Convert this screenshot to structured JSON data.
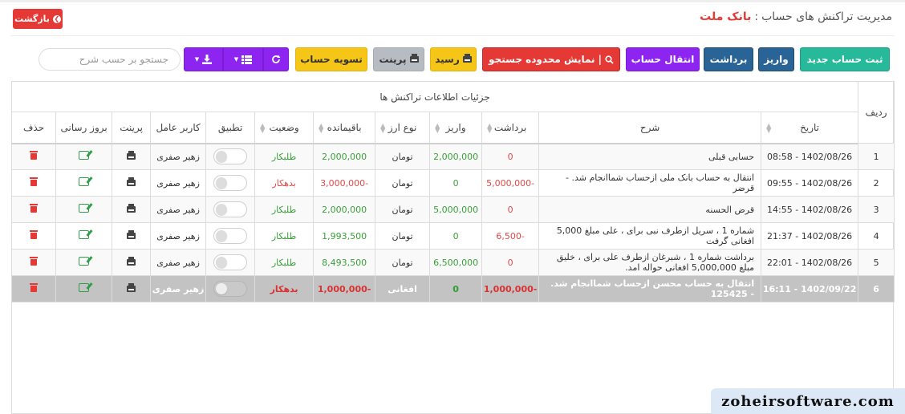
{
  "header": {
    "back_label": "بازگشت",
    "title": "مدیریت تراکنش های حساب",
    "separator": ":",
    "bank_name": "بانک ملت"
  },
  "toolbar": {
    "new_account": "ثبت حساب جدید",
    "deposit": "واریز",
    "withdraw": "برداشت",
    "transfer": "انتقال حساب",
    "show_search_range": "نمایش محدوده جستجو",
    "receipt": "رسید",
    "print": "پرینت",
    "settle": "تسویه حساب",
    "search_placeholder": "جستجو بر حسب شرح"
  },
  "table": {
    "caption": "جزئیات اطلاعات تراکنش ها",
    "columns": {
      "row": "ردیف",
      "date": "تاریخ",
      "description": "شرح",
      "withdraw": "برداشت",
      "deposit": "واریز",
      "currency": "نوع ارز",
      "balance": "باقیمانده",
      "status": "وضعیت",
      "reconcile": "تطبیق",
      "user": "کاربر عامل",
      "print": "پرینت",
      "update": "بروز رسانی",
      "delete": "حذف"
    },
    "rows": [
      {
        "row": "1",
        "date": "1402/08/26 - 08:58",
        "description": "حسابی قبلی",
        "withdraw": "0",
        "deposit": "2,000,000",
        "currency": "تومان",
        "balance": "2,000,000",
        "status": "طلبکار",
        "user": "زهیر صفری"
      },
      {
        "row": "2",
        "date": "1402/08/26 - 09:55",
        "description": "انتقال به حساب بانک ملی ازحساب شماانجام شد. - قرضر",
        "withdraw": "-5,000,000",
        "deposit": "0",
        "currency": "تومان",
        "balance": "-3,000,000",
        "status": "بدهکار",
        "user": "زهیر صفری"
      },
      {
        "row": "3",
        "date": "1402/08/26 - 14:55",
        "description": "قرض الحسنه",
        "withdraw": "0",
        "deposit": "5,000,000",
        "currency": "تومان",
        "balance": "2,000,000",
        "status": "طلبکار",
        "user": "زهیر صفری"
      },
      {
        "row": "4",
        "date": "1402/08/26 - 21:37",
        "description": "شماره 1 ، سریل ازطرف نبی برای ، علی مبلغ 5,000 افغانی گرفت",
        "withdraw": "-6,500",
        "deposit": "0",
        "currency": "تومان",
        "balance": "1,993,500",
        "status": "طلبکار",
        "user": "زهیر صفری"
      },
      {
        "row": "5",
        "date": "1402/08/26 - 22:01",
        "description": "برداشت شماره 1 ، شبرغان ازطرف علی برای ، خلیق مبلغ 5,000,000 افغانی حواله امد.",
        "withdraw": "0",
        "deposit": "6,500,000",
        "currency": "تومان",
        "balance": "8,493,500",
        "status": "طلبکار",
        "user": "زهیر صفری"
      },
      {
        "row": "6",
        "date": "1402/09/22 - 16:11",
        "description": "انتقال به حساب محسن ازحساب شماانجام شد. - 125425",
        "withdraw": "-1,000,000",
        "deposit": "0",
        "currency": "افغانی",
        "balance": "-1,000,000",
        "status": "بدهکار",
        "user": "زهیر صفری"
      }
    ]
  },
  "watermark": "zoheirsoftware.com",
  "colors": {
    "teal": "#26b99a",
    "navy": "#2a6496",
    "purple": "#8e24f0",
    "red": "#e53935",
    "yellow": "#f5c518",
    "gray": "#b7bcc3",
    "positive": "#39a139",
    "negative": "#e04848",
    "selected_row": "#c3c3c3"
  }
}
